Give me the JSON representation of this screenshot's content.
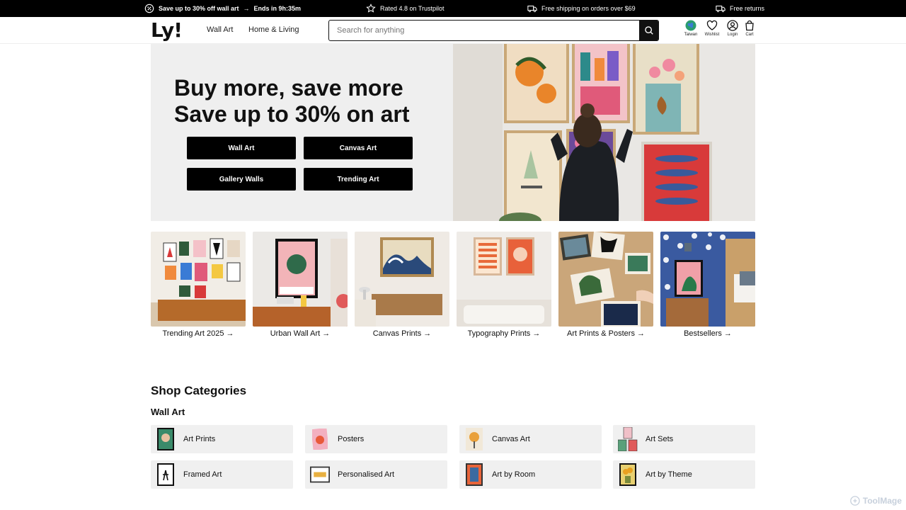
{
  "promo": {
    "sale": "Save up to 30% off wall art",
    "sale_arrow": "→",
    "countdown": "Ends in 9h:35m",
    "rating": "Rated 4.8 on Trustpilot",
    "shipping": "Free shipping on orders over $69",
    "returns": "Free returns"
  },
  "header": {
    "logo": "Ly!",
    "nav": [
      "Wall Art",
      "Home & Living"
    ],
    "search_placeholder": "Search for anything",
    "icons": {
      "region": "Taiwan",
      "wishlist": "Wishlist",
      "login": "Login",
      "cart": "Cart"
    }
  },
  "hero": {
    "title_line1": "Buy more, save more",
    "title_line2": "Save up to 30% on art",
    "buttons": [
      "Wall Art",
      "Canvas Art",
      "Gallery Walls",
      "Trending Art"
    ]
  },
  "categories": [
    "Trending Art 2025 →",
    "Urban Wall Art →",
    "Canvas Prints →",
    "Typography Prints →",
    "Art Prints & Posters →",
    "Bestsellers →"
  ],
  "shop": {
    "title": "Shop Categories",
    "subtitle": "Wall Art",
    "tiles": [
      "Art Prints",
      "Posters",
      "Canvas Art",
      "Art Sets",
      "Framed Art",
      "Personalised Art",
      "Art by Room",
      "Art by Theme"
    ]
  },
  "watermark": "ToolMage",
  "colors": {
    "accent": "#000000",
    "tile_bg": "#f0f0f0",
    "hero_bg": "#efefef"
  }
}
